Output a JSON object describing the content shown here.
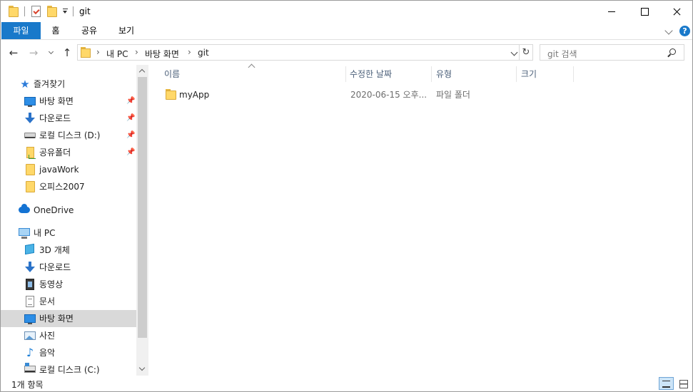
{
  "window": {
    "title": "git",
    "colors": {
      "accent": "#1979ca",
      "selection": "#d9d9d9",
      "header_text": "#4c607a"
    }
  },
  "quick_access_toolbar": {
    "icons": [
      "folder-icon",
      "properties-icon",
      "new-folder-icon",
      "customize-dropdown-icon"
    ]
  },
  "ribbon": {
    "tabs": [
      {
        "label": "파일",
        "active": true
      },
      {
        "label": "홈"
      },
      {
        "label": "공유"
      },
      {
        "label": "보기"
      }
    ],
    "help_label": "?"
  },
  "address_bar": {
    "breadcrumbs": [
      "내 PC",
      "바탕 화면",
      "git"
    ],
    "separator": "›"
  },
  "search": {
    "placeholder": "git 검색"
  },
  "sidebar": {
    "quick_access": {
      "label": "즐겨찾기",
      "icon": "star-icon"
    },
    "pinned": [
      {
        "label": "바탕 화면",
        "icon": "desktop-icon",
        "pinned": true
      },
      {
        "label": "다운로드",
        "icon": "download-icon",
        "pinned": true
      },
      {
        "label": "로컬 디스크 (D:)",
        "icon": "drive-icon",
        "pinned": true
      },
      {
        "label": "공유폴더",
        "icon": "shared-folder-icon",
        "pinned": true
      },
      {
        "label": "javaWork",
        "icon": "folder-icon",
        "pinned": false
      },
      {
        "label": "오피스2007",
        "icon": "folder-icon",
        "pinned": false
      }
    ],
    "onedrive": {
      "label": "OneDrive",
      "icon": "onedrive-cloud-icon"
    },
    "this_pc": {
      "label": "내 PC",
      "icon": "computer-icon"
    },
    "pc_items": [
      {
        "label": "3D 개체",
        "icon": "3d-objects-icon"
      },
      {
        "label": "다운로드",
        "icon": "download-icon"
      },
      {
        "label": "동영상",
        "icon": "video-icon"
      },
      {
        "label": "문서",
        "icon": "document-icon"
      },
      {
        "label": "바탕 화면",
        "icon": "desktop-icon",
        "selected": true
      },
      {
        "label": "사진",
        "icon": "pictures-icon"
      },
      {
        "label": "음악",
        "icon": "music-icon"
      },
      {
        "label": "로컬 디스크 (C:)",
        "icon": "system-drive-icon"
      }
    ]
  },
  "columns": {
    "name": "이름",
    "date": "수정한 날짜",
    "type": "유형",
    "size": "크기"
  },
  "files": [
    {
      "name": "myApp",
      "date": "2020-06-15 오후...",
      "type": "파일 폴더",
      "size": "",
      "icon": "folder-icon"
    }
  ],
  "status_bar": {
    "item_count": "1개 항목",
    "views": [
      "details-view-icon",
      "large-icons-view-icon"
    ],
    "active_view": "details"
  }
}
